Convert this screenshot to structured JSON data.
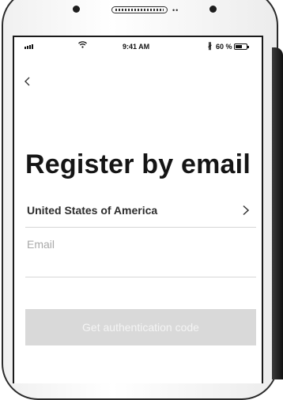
{
  "status_bar": {
    "time": "9:41 AM",
    "battery": "60 %",
    "bluetooth_icon": "bluetooth-icon",
    "wifi_icon": "wifi-icon",
    "signal_icon": "signal-icon"
  },
  "nav": {
    "back_icon": "chevron-left-icon"
  },
  "page": {
    "title": "Register by email"
  },
  "country": {
    "label": "United States of America",
    "chevron_icon": "chevron-right-icon"
  },
  "email": {
    "placeholder": "Email",
    "value": ""
  },
  "actions": {
    "auth_label": "Get authentication code"
  },
  "colors": {
    "button_disabled_bg": "#d9d9d9",
    "button_disabled_text": "#f4f4f4",
    "divider": "#d6d6d6",
    "title": "#151515"
  }
}
